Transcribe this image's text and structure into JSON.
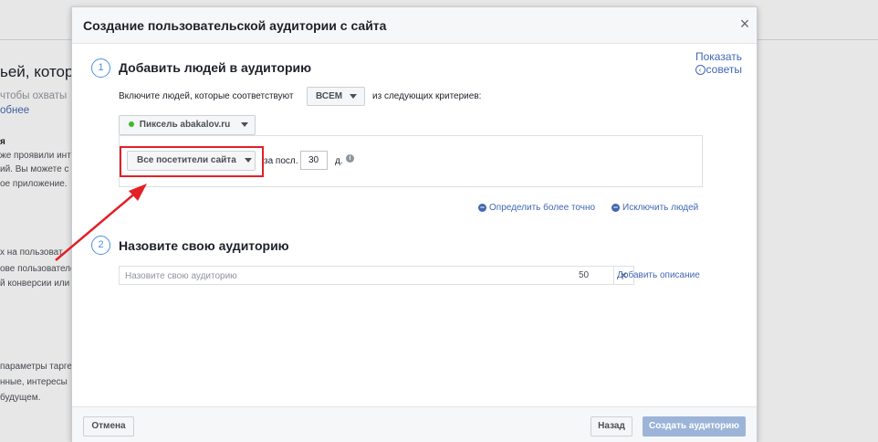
{
  "background": {
    "heading": "ьей, которы",
    "sub1": "чтобы охваты",
    "sub2": "обнее",
    "bold": "я",
    "lines": [
      "же проявили инте",
      "ий. Вы можете с",
      "ое приложение.",
      "х на пользоват",
      "ове пользователе",
      "й конверсии или",
      "параметры таргет",
      "нные, интересы",
      "будущем."
    ]
  },
  "modal": {
    "title": "Создание пользовательской аудитории с сайта",
    "close": "×",
    "tips": {
      "line1": "Показать",
      "icon": "‹",
      "line2": "советы"
    },
    "step1": {
      "number": "1",
      "title": "Добавить людей в аудиторию",
      "include_prefix": "Включите людей, которые соответствуют",
      "match_value": "ВСЕМ",
      "include_suffix": "из следующих критериев:",
      "pixel_label": "Пиксель abakalov.ru",
      "visitors_label": "Все посетители сайта",
      "period_prefix": "за посл.",
      "days_value": "30",
      "days_suffix": "д.",
      "info_icon": "i",
      "refine_link": "Определить более точно",
      "exclude_link": "Исключить людей"
    },
    "step2": {
      "number": "2",
      "title": "Назовите свою аудиторию",
      "name_placeholder": "Назовите свою аудиторию",
      "name_value": "",
      "char_count": "50",
      "clear": "×",
      "description_link": "Добавить описание"
    },
    "footer": {
      "cancel": "Отмена",
      "back": "Назад",
      "create": "Создать аудиторию"
    }
  },
  "colors": {
    "accent": "#4267b2",
    "highlight": "#e22026",
    "step": "#4a90e2",
    "create_disabled": "#9cb4d8"
  }
}
